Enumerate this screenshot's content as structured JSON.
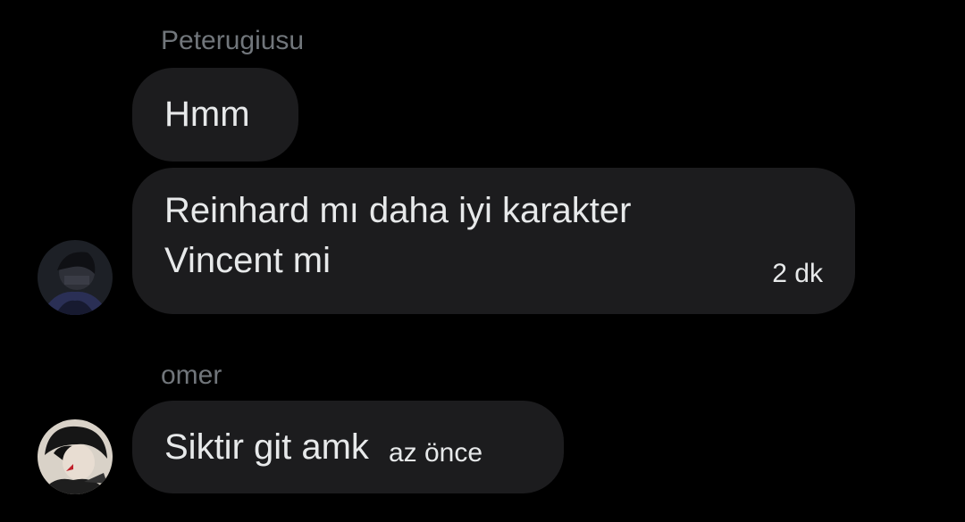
{
  "thread": {
    "groups": [
      {
        "sender": "Peterugiusu",
        "messages": [
          {
            "text": "Hmm"
          },
          {
            "text_line1": "Reinhard mı daha iyi karakter",
            "text_line2": "Vincent mi",
            "time": "2 dk"
          }
        ]
      },
      {
        "sender": "omer",
        "messages": [
          {
            "text": "Siktir git amk",
            "time": "az önce"
          }
        ]
      }
    ]
  },
  "colors": {
    "background": "#000000",
    "bubble": "#1c1c1e",
    "text": "#e7e9ea",
    "sender_name": "#71767b"
  },
  "icons": {
    "avatar_1": "avatar-image",
    "avatar_2": "avatar-image"
  }
}
